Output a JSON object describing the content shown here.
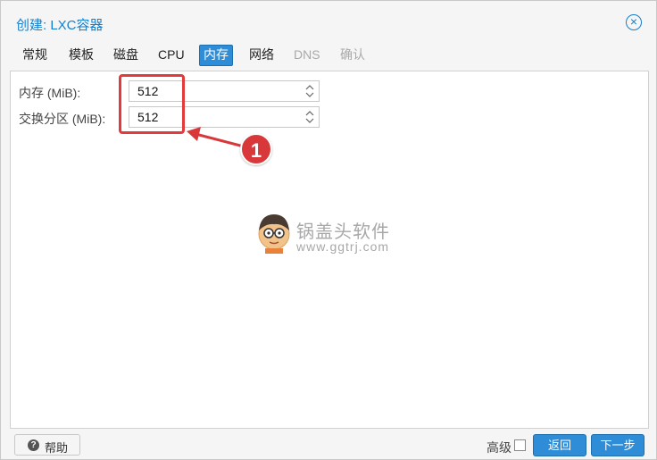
{
  "dialog": {
    "title": "创建: LXC容器",
    "close_icon": "close-circle-icon"
  },
  "tabs": [
    {
      "label": "常规",
      "state": "normal"
    },
    {
      "label": "模板",
      "state": "normal"
    },
    {
      "label": "磁盘",
      "state": "normal"
    },
    {
      "label": "CPU",
      "state": "normal"
    },
    {
      "label": "内存",
      "state": "active"
    },
    {
      "label": "网络",
      "state": "normal"
    },
    {
      "label": "DNS",
      "state": "disabled"
    },
    {
      "label": "确认",
      "state": "disabled"
    }
  ],
  "form": {
    "memory": {
      "label": "内存 (MiB):",
      "value": "512"
    },
    "swap": {
      "label": "交换分区 (MiB):",
      "value": "512"
    }
  },
  "annotation": {
    "badge": "1",
    "color": "#d9383a"
  },
  "watermark": {
    "title": "锅盖头软件",
    "url": "www.ggtrj.com"
  },
  "footer": {
    "help_label": "帮助",
    "advanced_label": "高级",
    "advanced_checked": false,
    "back_label": "返回",
    "next_label": "下一步"
  },
  "colors": {
    "accent": "#157fcc",
    "button": "#2e8dd6",
    "highlight": "#e23b3b"
  }
}
